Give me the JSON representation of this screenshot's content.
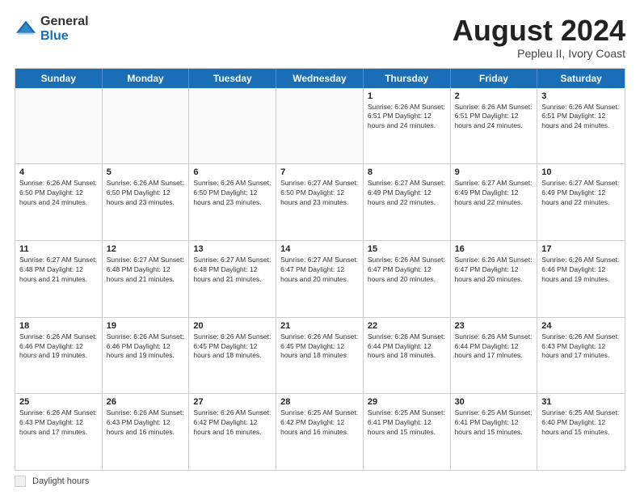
{
  "header": {
    "logo_general": "General",
    "logo_blue": "Blue",
    "main_title": "August 2024",
    "subtitle": "Pepleu II, Ivory Coast"
  },
  "footer": {
    "daylight_label": "Daylight hours"
  },
  "calendar": {
    "days_of_week": [
      "Sunday",
      "Monday",
      "Tuesday",
      "Wednesday",
      "Thursday",
      "Friday",
      "Saturday"
    ],
    "weeks": [
      [
        {
          "day": "",
          "info": "",
          "empty": true
        },
        {
          "day": "",
          "info": "",
          "empty": true
        },
        {
          "day": "",
          "info": "",
          "empty": true
        },
        {
          "day": "",
          "info": "",
          "empty": true
        },
        {
          "day": "1",
          "info": "Sunrise: 6:26 AM\nSunset: 6:51 PM\nDaylight: 12 hours\nand 24 minutes."
        },
        {
          "day": "2",
          "info": "Sunrise: 6:26 AM\nSunset: 6:51 PM\nDaylight: 12 hours\nand 24 minutes."
        },
        {
          "day": "3",
          "info": "Sunrise: 6:26 AM\nSunset: 6:51 PM\nDaylight: 12 hours\nand 24 minutes."
        }
      ],
      [
        {
          "day": "4",
          "info": "Sunrise: 6:26 AM\nSunset: 6:50 PM\nDaylight: 12 hours\nand 24 minutes."
        },
        {
          "day": "5",
          "info": "Sunrise: 6:26 AM\nSunset: 6:50 PM\nDaylight: 12 hours\nand 23 minutes."
        },
        {
          "day": "6",
          "info": "Sunrise: 6:26 AM\nSunset: 6:50 PM\nDaylight: 12 hours\nand 23 minutes."
        },
        {
          "day": "7",
          "info": "Sunrise: 6:27 AM\nSunset: 6:50 PM\nDaylight: 12 hours\nand 23 minutes."
        },
        {
          "day": "8",
          "info": "Sunrise: 6:27 AM\nSunset: 6:49 PM\nDaylight: 12 hours\nand 22 minutes."
        },
        {
          "day": "9",
          "info": "Sunrise: 6:27 AM\nSunset: 6:49 PM\nDaylight: 12 hours\nand 22 minutes."
        },
        {
          "day": "10",
          "info": "Sunrise: 6:27 AM\nSunset: 6:49 PM\nDaylight: 12 hours\nand 22 minutes."
        }
      ],
      [
        {
          "day": "11",
          "info": "Sunrise: 6:27 AM\nSunset: 6:48 PM\nDaylight: 12 hours\nand 21 minutes."
        },
        {
          "day": "12",
          "info": "Sunrise: 6:27 AM\nSunset: 6:48 PM\nDaylight: 12 hours\nand 21 minutes."
        },
        {
          "day": "13",
          "info": "Sunrise: 6:27 AM\nSunset: 6:48 PM\nDaylight: 12 hours\nand 21 minutes."
        },
        {
          "day": "14",
          "info": "Sunrise: 6:27 AM\nSunset: 6:47 PM\nDaylight: 12 hours\nand 20 minutes."
        },
        {
          "day": "15",
          "info": "Sunrise: 6:26 AM\nSunset: 6:47 PM\nDaylight: 12 hours\nand 20 minutes."
        },
        {
          "day": "16",
          "info": "Sunrise: 6:26 AM\nSunset: 6:47 PM\nDaylight: 12 hours\nand 20 minutes."
        },
        {
          "day": "17",
          "info": "Sunrise: 6:26 AM\nSunset: 6:46 PM\nDaylight: 12 hours\nand 19 minutes."
        }
      ],
      [
        {
          "day": "18",
          "info": "Sunrise: 6:26 AM\nSunset: 6:46 PM\nDaylight: 12 hours\nand 19 minutes."
        },
        {
          "day": "19",
          "info": "Sunrise: 6:26 AM\nSunset: 6:46 PM\nDaylight: 12 hours\nand 19 minutes."
        },
        {
          "day": "20",
          "info": "Sunrise: 6:26 AM\nSunset: 6:45 PM\nDaylight: 12 hours\nand 18 minutes."
        },
        {
          "day": "21",
          "info": "Sunrise: 6:26 AM\nSunset: 6:45 PM\nDaylight: 12 hours\nand 18 minutes."
        },
        {
          "day": "22",
          "info": "Sunrise: 6:26 AM\nSunset: 6:44 PM\nDaylight: 12 hours\nand 18 minutes."
        },
        {
          "day": "23",
          "info": "Sunrise: 6:26 AM\nSunset: 6:44 PM\nDaylight: 12 hours\nand 17 minutes."
        },
        {
          "day": "24",
          "info": "Sunrise: 6:26 AM\nSunset: 6:43 PM\nDaylight: 12 hours\nand 17 minutes."
        }
      ],
      [
        {
          "day": "25",
          "info": "Sunrise: 6:26 AM\nSunset: 6:43 PM\nDaylight: 12 hours\nand 17 minutes."
        },
        {
          "day": "26",
          "info": "Sunrise: 6:26 AM\nSunset: 6:43 PM\nDaylight: 12 hours\nand 16 minutes."
        },
        {
          "day": "27",
          "info": "Sunrise: 6:26 AM\nSunset: 6:42 PM\nDaylight: 12 hours\nand 16 minutes."
        },
        {
          "day": "28",
          "info": "Sunrise: 6:25 AM\nSunset: 6:42 PM\nDaylight: 12 hours\nand 16 minutes."
        },
        {
          "day": "29",
          "info": "Sunrise: 6:25 AM\nSunset: 6:41 PM\nDaylight: 12 hours\nand 15 minutes."
        },
        {
          "day": "30",
          "info": "Sunrise: 6:25 AM\nSunset: 6:41 PM\nDaylight: 12 hours\nand 15 minutes."
        },
        {
          "day": "31",
          "info": "Sunrise: 6:25 AM\nSunset: 6:40 PM\nDaylight: 12 hours\nand 15 minutes."
        }
      ]
    ]
  }
}
